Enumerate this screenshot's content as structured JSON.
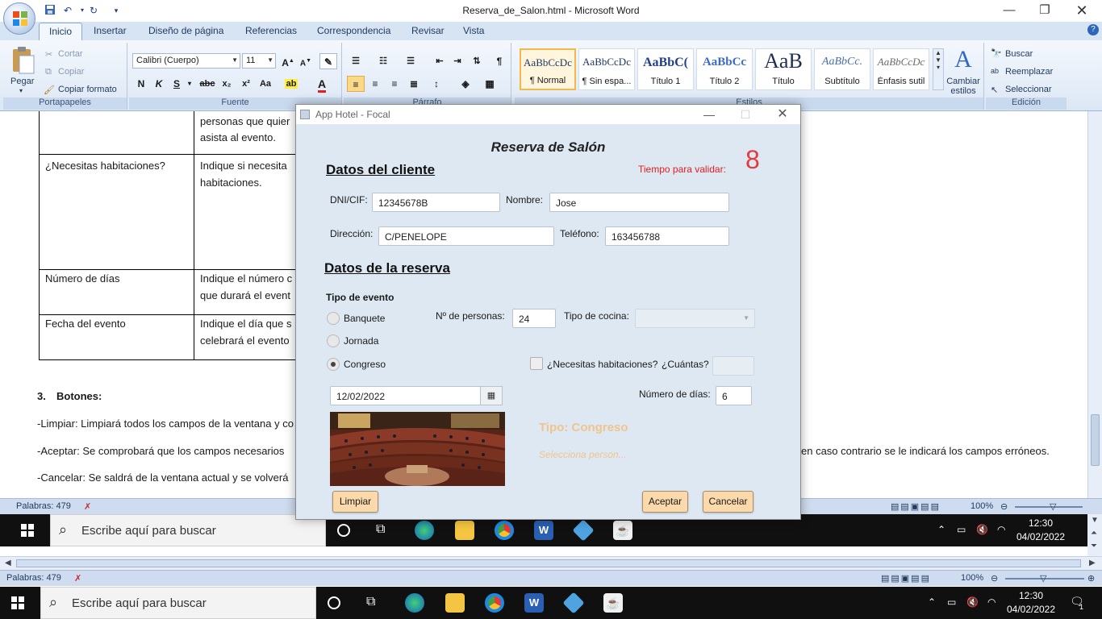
{
  "word": {
    "title": "Reserva_de_Salon.html - Microsoft Word",
    "tabs": [
      "Inicio",
      "Insertar",
      "Diseño de página",
      "Referencias",
      "Correspondencia",
      "Revisar",
      "Vista"
    ],
    "clipboard": {
      "paste": "Pegar",
      "cut": "Cortar",
      "copy": "Copiar",
      "format_painter": "Copiar formato",
      "group": "Portapapeles"
    },
    "font": {
      "name": "Calibri (Cuerpo)",
      "size": "11",
      "group": "Fuente"
    },
    "paragraph": {
      "group": "Párrafo"
    },
    "styles": {
      "items": [
        {
          "sample": "AaBbCcDc",
          "name": "¶ Normal"
        },
        {
          "sample": "AaBbCcDc",
          "name": "¶ Sin espa..."
        },
        {
          "sample": "AaBbC(",
          "name": "Título 1"
        },
        {
          "sample": "AaBbCc",
          "name": "Título 2"
        },
        {
          "sample": "AaB",
          "name": "Título"
        },
        {
          "sample": "AaBbCc.",
          "name": "Subtítulo"
        },
        {
          "sample": "AaBbCcDc",
          "name": "Énfasis sutil"
        }
      ],
      "change": "Cambiar estilos",
      "group": "Estilos"
    },
    "editing": {
      "find": "Buscar",
      "replace": "Reemplazar",
      "select": "Seleccionar",
      "group": "Edición"
    },
    "doc": {
      "row0_right_1": "personas que quier",
      "row0_right_2": "asista al evento.",
      "row1_left": "¿Necesitas habitaciones?",
      "row1_right_1": "Indique si necesita",
      "row1_right_2": "habitaciones.",
      "row2_left": "Número de días",
      "row2_right_1": "Indique el número c",
      "row2_right_2": "que durará el event",
      "row3_left": "Fecha del evento",
      "row3_right_1": "Indique el día que s",
      "row3_right_2": "celebrará el evento",
      "section_num": "3.",
      "section_title": "Botones:",
      "p1": "-Limpiar: Limpiará todos los campos de la ventana y co",
      "p2": "-Aceptar: Se comprobará que los campos necesarios",
      "p2_tail": "en caso contrario se le indicará los campos erróneos.",
      "p3": "-Cancelar: Se saldrá de la ventana actual y se volverá"
    },
    "status_words": "Palabras: 479",
    "zoom": "100%"
  },
  "taskbar": {
    "search_placeholder": "Escribe aquí para buscar",
    "time": "12:30",
    "date": "04/02/2022",
    "notif_count": "1"
  },
  "dialog": {
    "window_title": "App Hotel - Focal",
    "heading": "Reserva de Salón",
    "client_section": "Datos del cliente",
    "timer_label": "Tiempo para validar:",
    "timer_value": "8",
    "dni_label": "DNI/CIF:",
    "dni_value": "12345678B",
    "name_label": "Nombre:",
    "name_value": "Jose",
    "address_label": "Dirección:",
    "address_value": "C/PENELOPE",
    "phone_label": "Teléfono:",
    "phone_value": "163456788",
    "reservation_section": "Datos de la reserva",
    "event_type_label": "Tipo de evento",
    "event_options": [
      "Banquete",
      "Jornada",
      "Congreso"
    ],
    "event_selected": "Congreso",
    "people_label": "Nº de personas:",
    "people_value": "24",
    "cuisine_label": "Tipo de cocina:",
    "rooms_label": "¿Necesitas habitaciones?",
    "rooms_checked": false,
    "how_many_label": "¿Cuántas?",
    "date_value": "12/02/2022",
    "days_label": "Número de días:",
    "days_value": "6",
    "type_display": "Tipo: Congreso",
    "hint_text": "Selecciona person...",
    "btn_clear": "Limpiar",
    "btn_accept": "Aceptar",
    "btn_cancel": "Cancelar",
    "colors": {
      "timer": "#e23b3b",
      "timer_label": "#e02020",
      "type_display": "#f0c48c",
      "button_bg": "#fcd9aa",
      "dialog_bg": "#dde8f2"
    }
  }
}
